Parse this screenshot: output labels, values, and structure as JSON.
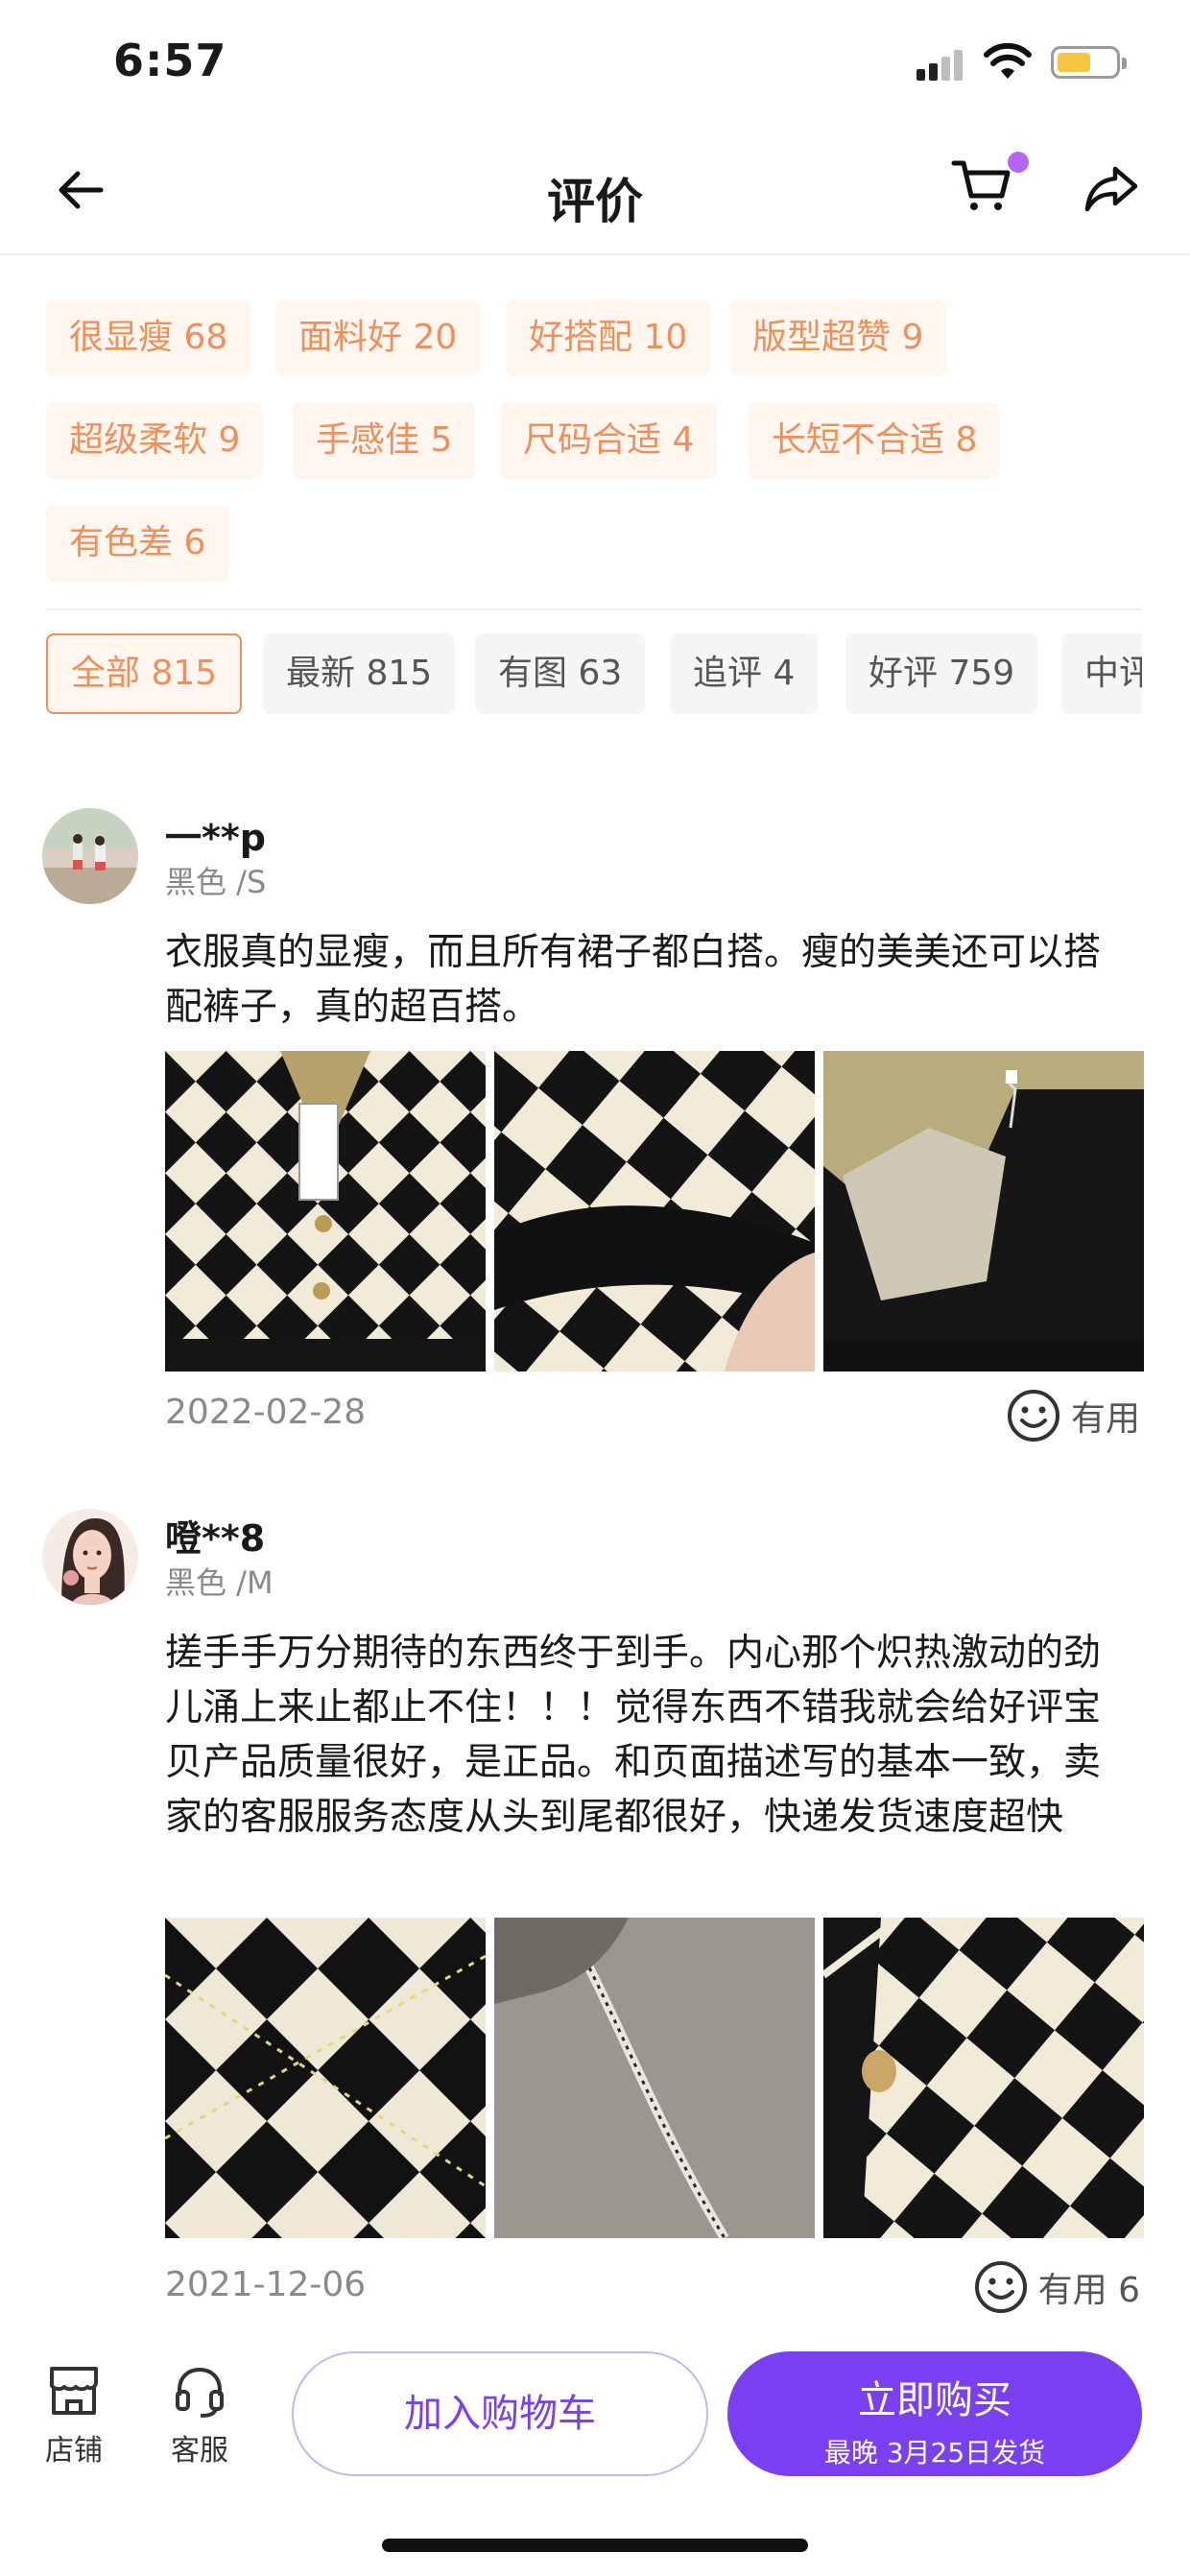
{
  "status_bar": {
    "time": "6:57"
  },
  "nav": {
    "title": "评价",
    "cart_icon": "cart-icon",
    "back_icon": "arrow-left-icon",
    "share_icon": "share-icon"
  },
  "tags": [
    "很显瘦 68",
    "面料好 20",
    "好搭配 10",
    "版型超赞 9",
    "超级柔软 9",
    "手感佳 5",
    "尺码合适 4",
    "长短不合适 8",
    "有色差 6"
  ],
  "filters": [
    {
      "label": "全部 815",
      "active": true
    },
    {
      "label": "最新 815"
    },
    {
      "label": "有图 63"
    },
    {
      "label": "追评 4"
    },
    {
      "label": "好评 759"
    },
    {
      "label": "中评"
    }
  ],
  "reviews": [
    {
      "username": "一**p",
      "sku": "黑色 /S",
      "content": "衣服真的显瘦，而且所有裙子都白搭。瘦的美美还可以搭配裤子，真的超百搭。",
      "date": "2022-02-28",
      "useful_label": "有用"
    },
    {
      "username": "噔**8",
      "sku": "黑色 /M",
      "content": "搓手手万分期待的东西终于到手。内心那个炽热激动的劲儿涌上来止都止不住！！！觉得东西不错我就会给好评宝贝产品质量很好，是正品。和页面描述写的基本一致，卖家的客服服务态度从头到尾都很好，快递发货速度超快",
      "date": "2021-12-06",
      "useful_label": "有用 6"
    }
  ],
  "bottom_bar": {
    "shop_label": "店铺",
    "service_label": "客服",
    "add_cart_label": "加入购物车",
    "buy_label": "立即购买",
    "buy_sub": "最晚 3月25日发货"
  },
  "colors": {
    "accent": "#7a3ff0",
    "tag_text": "#ef8f5a",
    "tag_bg": "#fff6f0"
  }
}
